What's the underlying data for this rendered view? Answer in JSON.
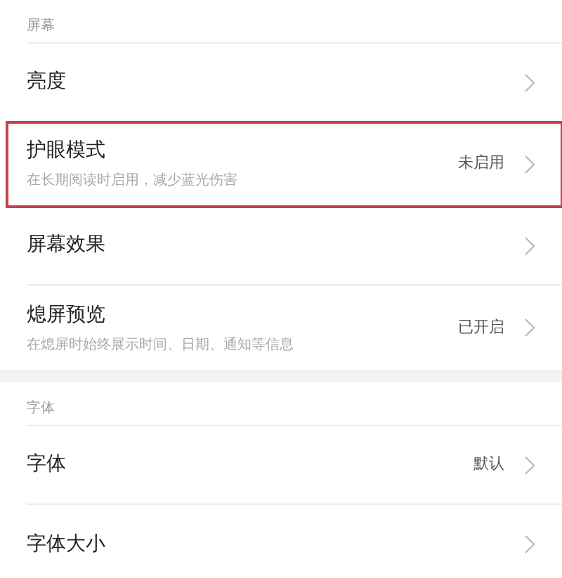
{
  "sections": [
    {
      "header": "屏幕",
      "items": [
        {
          "title": "亮度",
          "highlighted": false
        },
        {
          "title": "护眼模式",
          "subtitle": "在长期阅读时启用，减少蓝光伤害",
          "value": "未启用",
          "highlighted": true
        },
        {
          "title": "屏幕效果",
          "highlighted": false
        },
        {
          "title": "熄屏预览",
          "subtitle": "在熄屏时始终展示时间、日期、通知等信息",
          "value": "已开启",
          "highlighted": false
        }
      ]
    },
    {
      "header": "字体",
      "items": [
        {
          "title": "字体",
          "value": "默认",
          "highlighted": false
        },
        {
          "title": "字体大小",
          "highlighted": false
        }
      ]
    }
  ]
}
